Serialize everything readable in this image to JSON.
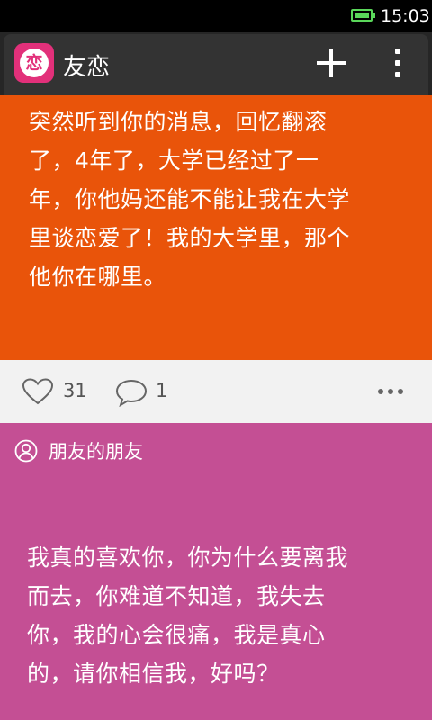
{
  "status_bar": {
    "time": "15:03",
    "battery_icon": "battery-full-icon",
    "battery_color": "#5ad75a"
  },
  "action_bar": {
    "logo_char": "恋",
    "title": "友恋",
    "add_icon": "plus-icon",
    "menu_icon": "overflow-menu-icon",
    "accent": "#e2307a"
  },
  "posts": [
    {
      "background": "#e9540a",
      "lines": [
        "突然听到你的消息，回忆翻滚",
        "了，4年了，大学已经过了一",
        "年，你他妈还能不能让我在大学",
        "里谈恋爱了！我的大学里，那个",
        "他你在哪里。"
      ],
      "likes": "31",
      "comments": "1",
      "like_icon": "heart-icon",
      "comment_icon": "comment-icon",
      "more_icon": "more-horizontal-icon"
    },
    {
      "background": "#c44f94",
      "source_icon": "user-circle-icon",
      "source": "朋友的朋友",
      "lines": [
        "我真的喜欢你，你为什么要离我",
        "而去，你难道不知道，我失去",
        "你，我的心会很痛，我是真心",
        "的，请你相信我，好吗？"
      ]
    }
  ]
}
